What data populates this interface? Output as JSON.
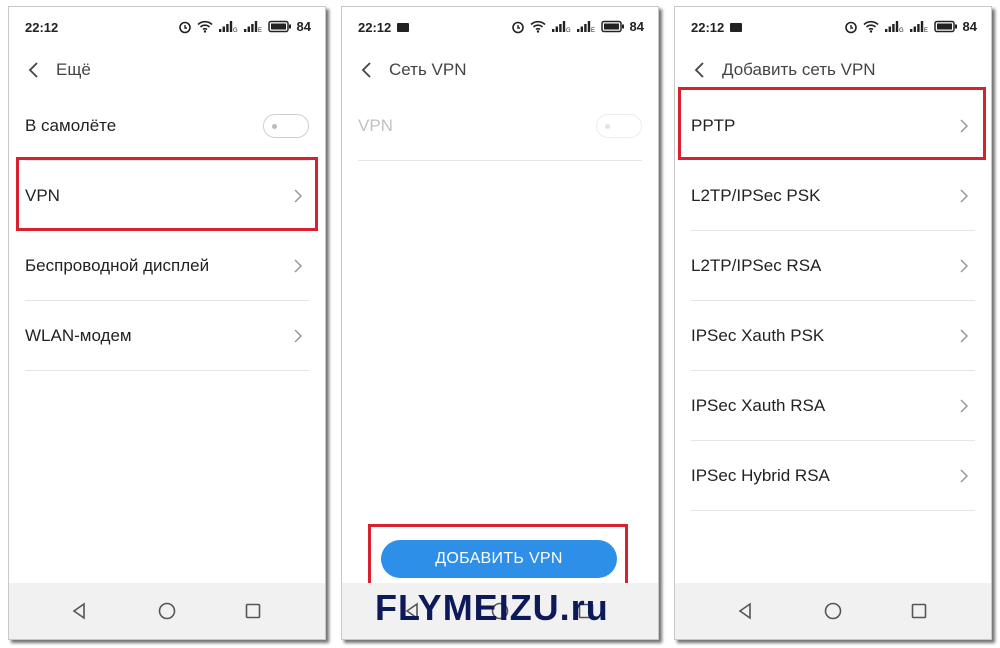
{
  "status": {
    "time": "22:12",
    "network_label": "G",
    "network_label_2": "E",
    "battery": "84"
  },
  "screens": [
    {
      "title": "Ещё",
      "rows": [
        {
          "label": "В самолёте",
          "control": "toggle"
        },
        {
          "label": "VPN",
          "control": "chevron"
        },
        {
          "label": "Беспроводной дисплей",
          "control": "chevron"
        },
        {
          "label": "WLAN-модем",
          "control": "chevron"
        }
      ]
    },
    {
      "title": "Сеть VPN",
      "rows": [
        {
          "label": "VPN",
          "control": "toggle",
          "disabled": true
        }
      ],
      "add_button_label": "ДОБАВИТЬ VPN"
    },
    {
      "title": "Добавить сеть VPN",
      "rows": [
        {
          "label": "PPTP",
          "control": "chevron"
        },
        {
          "label": "L2TP/IPSec PSK",
          "control": "chevron"
        },
        {
          "label": "L2TP/IPSec RSA",
          "control": "chevron"
        },
        {
          "label": "IPSec Xauth PSK",
          "control": "chevron"
        },
        {
          "label": "IPSec Xauth RSA",
          "control": "chevron"
        },
        {
          "label": "IPSec Hybrid RSA",
          "control": "chevron"
        }
      ]
    }
  ],
  "watermark": "FLYMEIZU.ru",
  "colors": {
    "highlight": "#d9202e",
    "button": "#2d8fe8",
    "watermark": "#0c1a5a"
  }
}
